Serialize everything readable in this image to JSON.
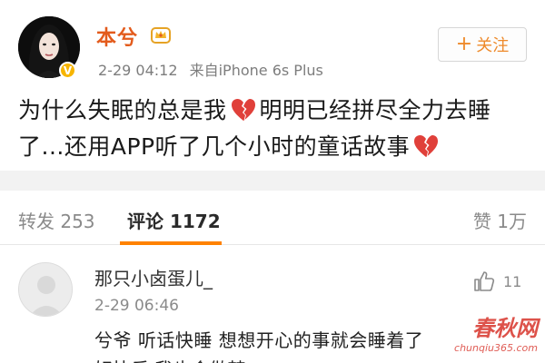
{
  "post": {
    "username": "本兮",
    "timestamp": "2-29 04:12",
    "source": "来自iPhone 6s Plus",
    "follow_label": "关注",
    "text_part1": "为什么失眠的总是我",
    "text_part2": "明明已经拼尽全力去睡了...还用APP听了几个小时的童话故事",
    "icons": [
      "avatar",
      "verified-badge-icon",
      "crown-icon",
      "broken-heart-icon",
      "plus-icon"
    ]
  },
  "tabs": {
    "repost": "转发 253",
    "comment": "评论 1172",
    "like": "赞 1万"
  },
  "comment": {
    "name": "那只小卤蛋儿_",
    "time": "2-29 06:46",
    "like_count": "11",
    "text": "兮爷  听话快睡  想想开心的事就会睡着了",
    "text_line2": "好快乐  我也会做梦"
  },
  "watermark": {
    "big": "春秋网",
    "small": "chunqiu365.com"
  },
  "colors": {
    "username": "#e35b1c",
    "accent_orange": "#ff8200",
    "follow_text": "#ee8a2b",
    "heart_red": "#e0403a",
    "verified": "#f7b500"
  }
}
